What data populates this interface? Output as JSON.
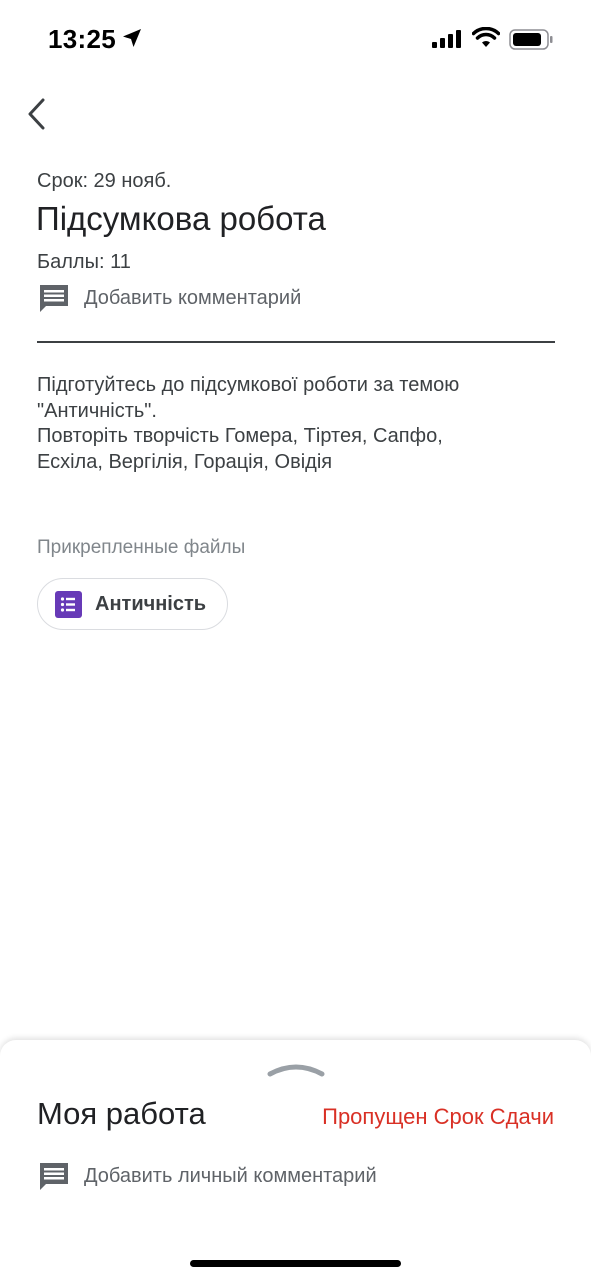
{
  "status_bar": {
    "time": "13:25",
    "icons": [
      "location-arrow-icon",
      "cellular-signal-icon",
      "wifi-icon",
      "battery-icon"
    ]
  },
  "nav": {
    "back_icon": "chevron-left-icon"
  },
  "assignment": {
    "due": "Срок: 29 нояб.",
    "title": "Підсумкова робота",
    "points": "Баллы: 11",
    "add_comment": "Добавить комментарий",
    "description_lines": [
      "Підготуйтесь до підсумкової роботи за темою",
      "\"Античність\".",
      "Повторіть творчість Гомера, Тіртея, Сапфо,",
      "Есхіла, Вергілія, Горація, Овідія"
    ]
  },
  "attachments": {
    "label": "Прикрепленные файлы",
    "files": [
      {
        "name": "Античність",
        "icon": "google-forms-icon",
        "icon_color": "#673ab7"
      }
    ]
  },
  "my_work": {
    "title": "Моя работа",
    "status": "Пропущен Срок Сдачи",
    "status_color": "#d93025",
    "add_private_comment": "Добавить личный комментарий",
    "handle_icon": "chevron-up-icon"
  }
}
